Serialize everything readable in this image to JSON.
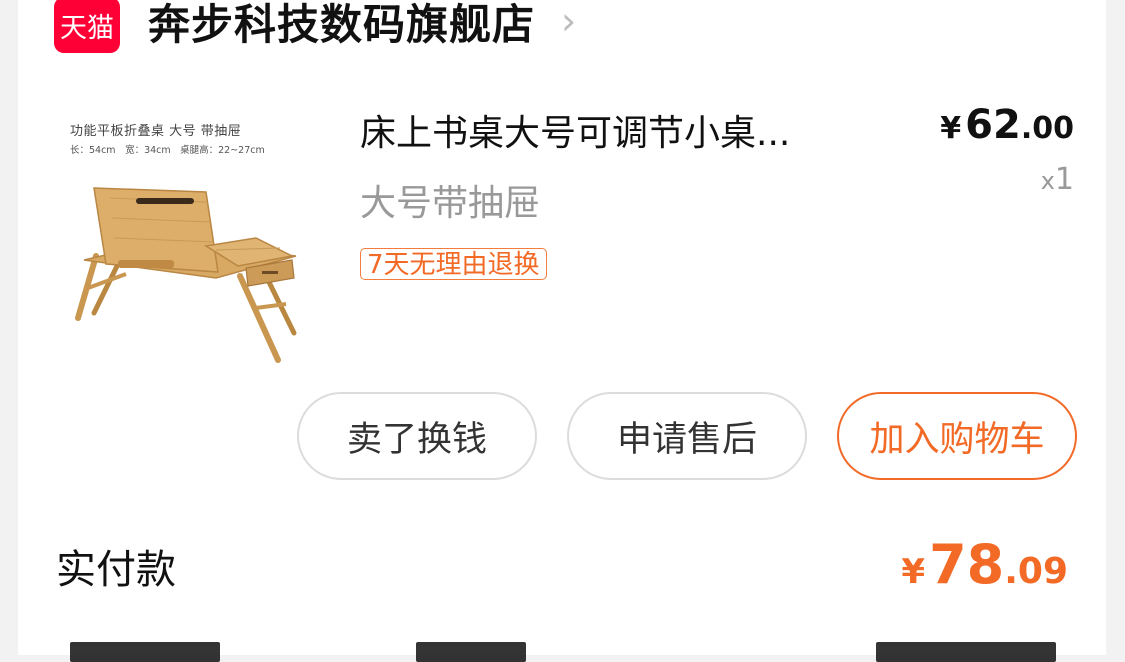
{
  "shop": {
    "badge_text": "天猫",
    "name": "奔步科技数码旗舰店",
    "chevron": "›"
  },
  "product": {
    "image_caption_line1": "功能平板折叠桌 大号 带抽屉",
    "image_caption_line2": "长：54cm　宽：34cm　桌腿高：22~27cm",
    "title": "床上书桌大号可调节小桌...",
    "sku": "大号带抽屉",
    "return_badge": "7天无理由退换",
    "price": {
      "currency": "¥",
      "integer": "62",
      "decimal": ".00"
    },
    "quantity": {
      "prefix": "x",
      "value": "1"
    }
  },
  "actions": {
    "sell": "卖了换钱",
    "after_sales": "申请售后",
    "add_to_cart": "加入购物车"
  },
  "payment": {
    "label": "实付款",
    "currency": "¥",
    "integer": "78",
    "decimal": ".09"
  },
  "colors": {
    "accent": "#f26a26",
    "tmall_red": "#ff0036",
    "muted": "#999999"
  }
}
